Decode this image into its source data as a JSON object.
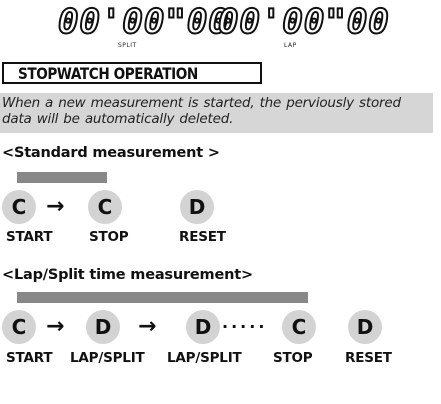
{
  "lcd": {
    "split_digits": "00'00\"00",
    "split_caption": "SPLIT",
    "lap_digits": "00'00\"00",
    "lap_caption": "LAP"
  },
  "section_title": "STOPWATCH OPERATION",
  "note": "When a new measurement is started, the perviously stored data will be automatically deleted.",
  "standard": {
    "heading": "<Standard measurement >",
    "keys": [
      "C",
      "C",
      "D"
    ],
    "arrow": "→",
    "labels": [
      "START",
      "STOP",
      "RESET"
    ]
  },
  "lapsplit": {
    "heading": "<Lap/Split time measurement>",
    "keys": [
      "C",
      "D",
      "D",
      "C",
      "D"
    ],
    "arrow": "→",
    "dots": "·····",
    "labels": [
      "START",
      "LAP/SPLIT",
      "LAP/SPLIT",
      "STOP",
      "RESET"
    ]
  },
  "colors": {
    "bar": "#888888",
    "key_fill": "#d3d3d3",
    "note_band": "#d6d6d6"
  }
}
